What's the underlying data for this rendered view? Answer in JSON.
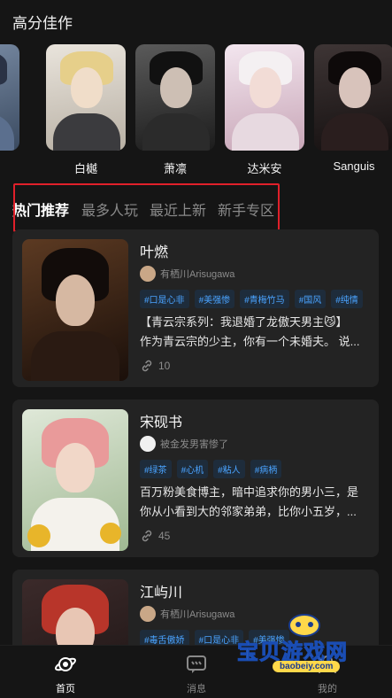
{
  "featured": {
    "title": "高分佳作",
    "characters": [
      {
        "name": ""
      },
      {
        "name": "白樾"
      },
      {
        "name": "萧凛"
      },
      {
        "name": "达米安"
      },
      {
        "name": "Sanguis"
      }
    ]
  },
  "tabs": [
    {
      "label": "热门推荐",
      "active": true
    },
    {
      "label": "最多人玩",
      "active": false
    },
    {
      "label": "最近上新",
      "active": false
    },
    {
      "label": "新手专区",
      "active": false
    }
  ],
  "cards": [
    {
      "title": "叶燃",
      "author": "有栖川Arisugawa",
      "tags": [
        "#口是心非",
        "#美强惨",
        "#青梅竹马",
        "#国风",
        "#纯情"
      ],
      "desc": [
        "【青云宗系列：我退婚了龙傲天男主😼】",
        "作为青云宗的少主，你有一个未婚夫。 说..."
      ],
      "count": "10"
    },
    {
      "title": "宋砚书",
      "author": "被金发男害惨了",
      "tags": [
        "#绿茶",
        "#心机",
        "#粘人",
        "#病柄"
      ],
      "desc": [
        "百万粉美食博主，暗中追求你的男小三，是",
        "你从小看到大的邻家弟弟，比你小五岁，..."
      ],
      "count": "45"
    },
    {
      "title": "江屿川",
      "author": "有栖川Arisugawa",
      "tags": [
        "#毒舌傲娇",
        "#口是心非",
        "#美强惨"
      ],
      "desc": [
        "",
        ""
      ],
      "count": ""
    }
  ],
  "bottom_nav": [
    {
      "label": "首页",
      "icon": "home-planet-icon",
      "active": true
    },
    {
      "label": "消息",
      "icon": "message-icon",
      "active": false
    },
    {
      "label": "我的",
      "icon": "profile-icon",
      "active": false
    }
  ],
  "watermark": {
    "text": "宝贝游戏网",
    "url": "baobeiy.com"
  }
}
